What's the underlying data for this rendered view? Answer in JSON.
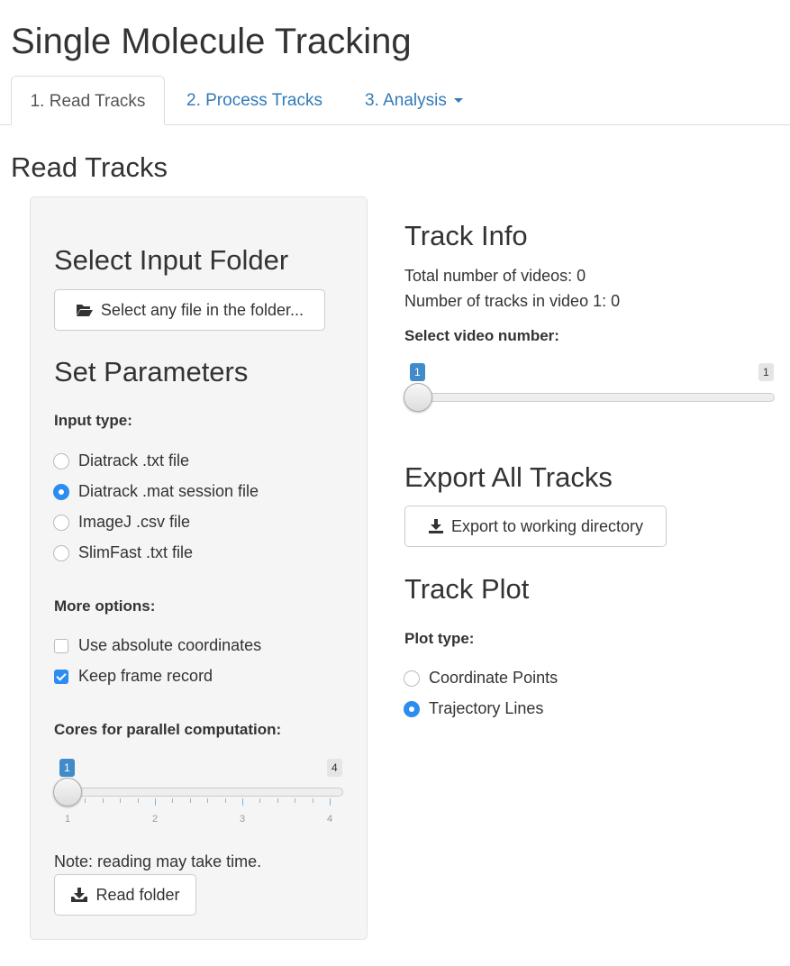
{
  "app_title": "Single Molecule Tracking",
  "tabs": [
    {
      "label": "1. Read Tracks",
      "active": true
    },
    {
      "label": "2. Process Tracks",
      "active": false
    },
    {
      "label": "3. Analysis",
      "active": false,
      "dropdown": true
    }
  ],
  "page_heading": "Read Tracks",
  "sidebar": {
    "select_folder": {
      "heading": "Select Input Folder",
      "button_label": "Select any file in the folder...",
      "button_icon": "folder-open-icon"
    },
    "set_parameters": {
      "heading": "Set Parameters",
      "input_type": {
        "label": "Input type:",
        "options": [
          {
            "label": "Diatrack .txt file",
            "selected": false
          },
          {
            "label": "Diatrack .mat session file",
            "selected": true
          },
          {
            "label": "ImageJ .csv file",
            "selected": false
          },
          {
            "label": "SlimFast .txt file",
            "selected": false
          }
        ]
      },
      "more_options": {
        "label": "More options:",
        "options": [
          {
            "label": "Use absolute coordinates",
            "checked": false
          },
          {
            "label": "Keep frame record",
            "checked": true
          }
        ]
      },
      "cores": {
        "label": "Cores for parallel computation:",
        "value": 1,
        "min": 1,
        "max": 4,
        "value_text": "1",
        "max_text": "4",
        "tick_labels": [
          "1",
          "2",
          "3",
          "4"
        ]
      }
    },
    "note": "Note: reading may take time.",
    "read_button": {
      "label": "Read folder",
      "icon": "inbox-download-icon"
    }
  },
  "track_info": {
    "heading": "Track Info",
    "total_videos": "Total number of videos: 0",
    "tracks_in_video": "Number of tracks in video 1: 0",
    "video_select": {
      "label": "Select video number:",
      "value": 1,
      "min": 1,
      "max": 1,
      "value_text": "1",
      "max_text": "1"
    }
  },
  "export": {
    "heading": "Export All Tracks",
    "button_label": "Export to working directory",
    "button_icon": "download-icon"
  },
  "track_plot": {
    "heading": "Track Plot",
    "plot_type": {
      "label": "Plot type:",
      "options": [
        {
          "label": "Coordinate Points",
          "selected": false
        },
        {
          "label": "Trajectory Lines",
          "selected": true
        }
      ]
    }
  },
  "colors": {
    "accent": "#2d8cf0",
    "link": "#337ab7",
    "badge_blue": "#428bca",
    "panel_bg": "#f5f5f5"
  }
}
